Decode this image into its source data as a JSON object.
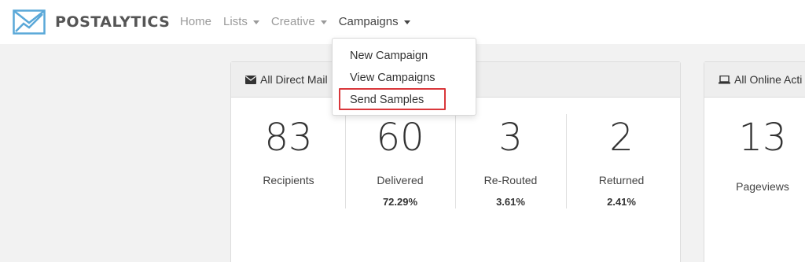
{
  "app": {
    "logo_text": "POSTALYTICS"
  },
  "nav": [
    {
      "label": "Home",
      "has_caret": false
    },
    {
      "label": "Lists",
      "has_caret": true
    },
    {
      "label": "Creative",
      "has_caret": true
    },
    {
      "label": "Campaigns",
      "has_caret": true
    }
  ],
  "dropdown": {
    "items": [
      "New Campaign",
      "View Campaigns",
      "Send Samples"
    ],
    "highlighted": "Send Samples"
  },
  "direct_mail": {
    "title": "All Direct Mail",
    "icon": "envelope-icon",
    "stats": [
      {
        "value": "83",
        "label": "Recipients",
        "percent": ""
      },
      {
        "value": "60",
        "label": "Delivered",
        "percent": "72.29%"
      },
      {
        "value": "3",
        "label": "Re-Routed",
        "percent": "3.61%"
      },
      {
        "value": "2",
        "label": "Returned",
        "percent": "2.41%"
      }
    ]
  },
  "online": {
    "title": "All Online Acti",
    "icon": "laptop-icon",
    "stats": [
      {
        "value": "13",
        "label": "Pageviews"
      }
    ]
  },
  "colors": {
    "highlight": "#d9373b",
    "logo_blue": "#5aa8d8"
  }
}
